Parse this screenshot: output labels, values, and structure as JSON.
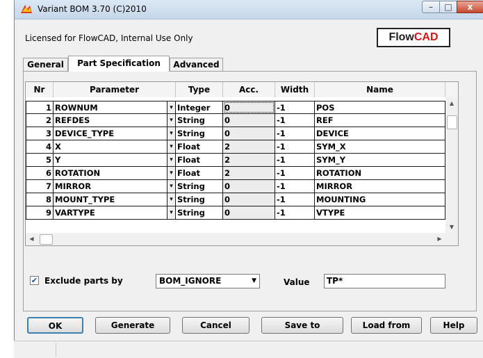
{
  "window": {
    "title": "Variant BOM 3.70 (C)2010",
    "minimize_glyph": "–",
    "maximize_glyph": "□",
    "close_glyph": "x"
  },
  "license_text": "Licensed for FlowCAD, Internal Use Only",
  "logo": {
    "part1": "Flow",
    "part2": "CAD",
    "accent_color": "#d01818"
  },
  "tabs": [
    "General",
    "Part Specification",
    "Advanced"
  ],
  "grid": {
    "columns": [
      "Nr",
      "Parameter",
      "Type",
      "Acc.",
      "Width",
      "Name"
    ],
    "dropdown_glyph": "▾",
    "rows": [
      {
        "nr": "1",
        "param": "ROWNUM",
        "type": "Integer",
        "acc": "0",
        "width": "-1",
        "name": "POS"
      },
      {
        "nr": "2",
        "param": "REFDES",
        "type": "String",
        "acc": "0",
        "width": "-1",
        "name": "REF"
      },
      {
        "nr": "3",
        "param": "DEVICE_TYPE",
        "type": "String",
        "acc": "0",
        "width": "-1",
        "name": "DEVICE"
      },
      {
        "nr": "4",
        "param": "X",
        "type": "Float",
        "acc": "2",
        "width": "-1",
        "name": "SYM_X"
      },
      {
        "nr": "5",
        "param": "Y",
        "type": "Float",
        "acc": "2",
        "width": "-1",
        "name": "SYM_Y"
      },
      {
        "nr": "6",
        "param": "ROTATION",
        "type": "Float",
        "acc": "2",
        "width": "-1",
        "name": "ROTATION"
      },
      {
        "nr": "7",
        "param": "MIRROR",
        "type": "String",
        "acc": "0",
        "width": "-1",
        "name": "MIRROR"
      },
      {
        "nr": "8",
        "param": "MOUNT_TYPE",
        "type": "String",
        "acc": "0",
        "width": "-1",
        "name": "MOUNTING"
      },
      {
        "nr": "9",
        "param": "VARTYPE",
        "type": "String",
        "acc": "0",
        "width": "-1",
        "name": "VTYPE"
      }
    ]
  },
  "exclude": {
    "checked": true,
    "check_glyph": "✔",
    "label": "Exclude parts by",
    "selected": "BOM_IGNORE",
    "value_label": "Value",
    "value": "TP*"
  },
  "buttons": {
    "ok": "OK",
    "generate": "Generate",
    "cancel": "Cancel",
    "save": "Save to",
    "load": "Load from",
    "help": "Help"
  }
}
